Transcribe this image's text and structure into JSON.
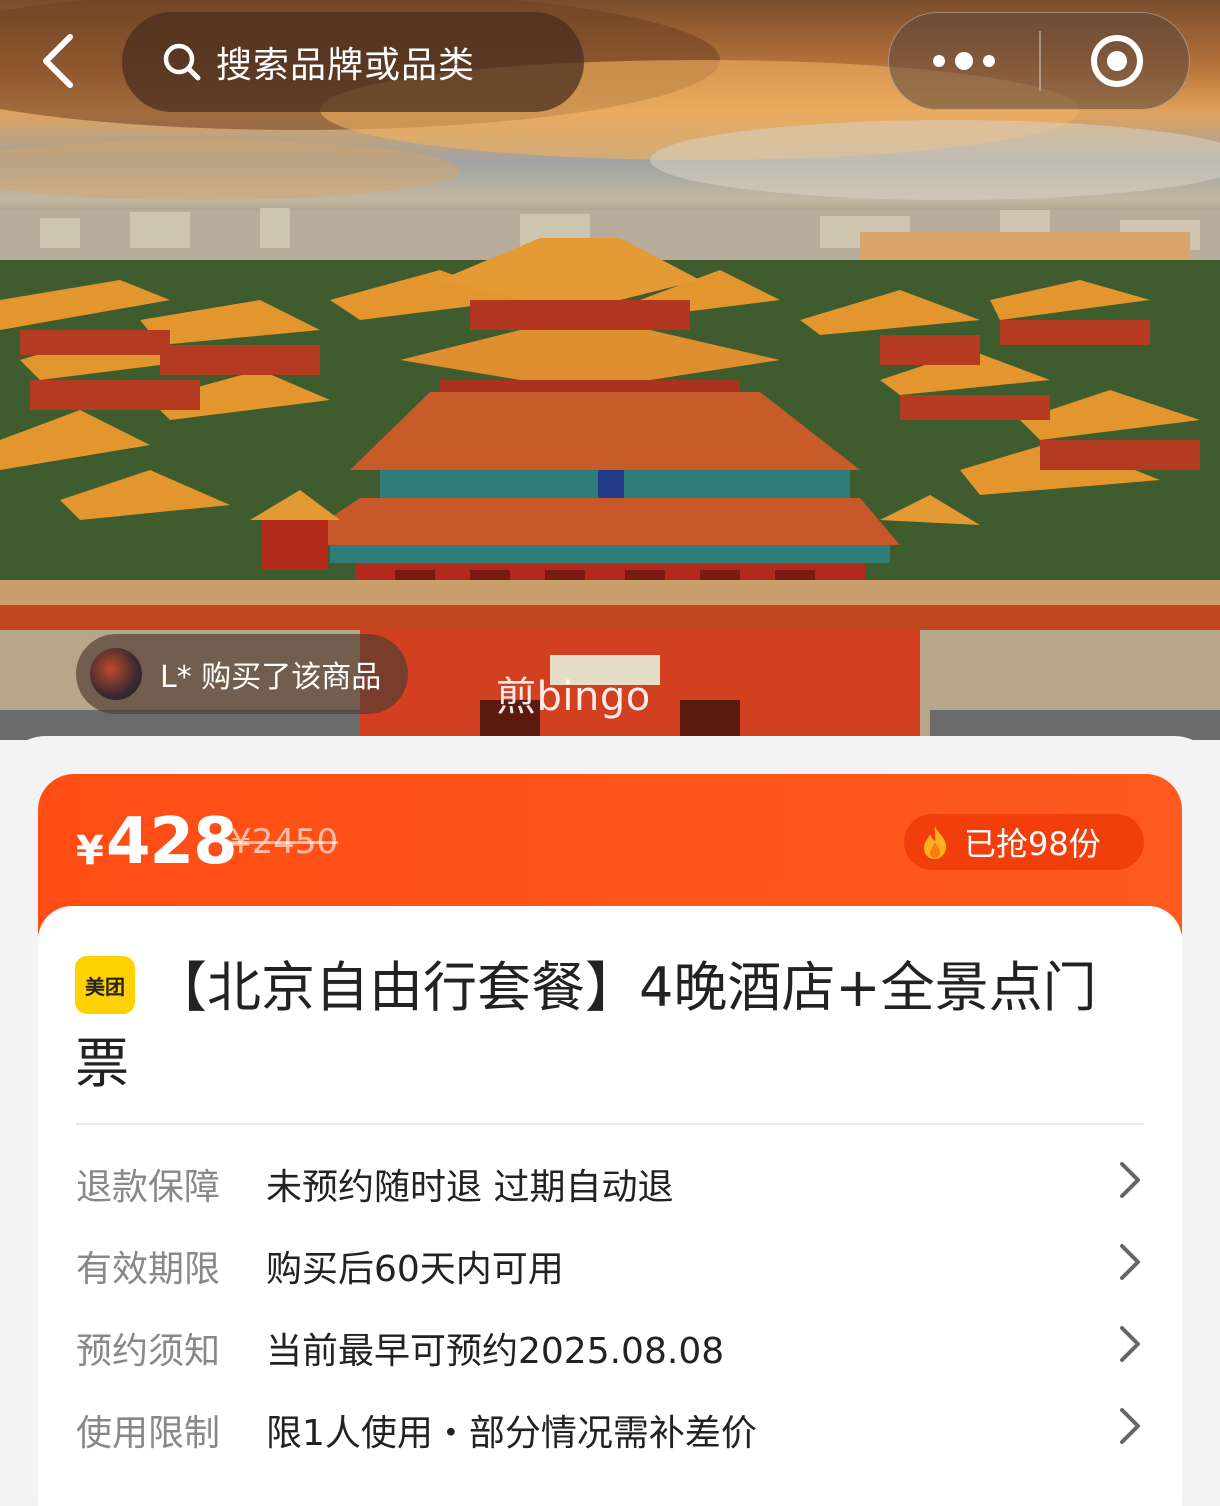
{
  "header": {
    "search_placeholder": "搜索品牌或品类",
    "icons": {
      "back": "back-arrow-icon",
      "search": "search-icon",
      "more": "more-dots-icon",
      "target": "target-icon"
    }
  },
  "hero": {
    "purchase_notice": "L* 购买了该商品",
    "watermark": "煎bingo"
  },
  "price": {
    "currency": "¥",
    "current": "428",
    "original": "¥2450",
    "sold_count": "已抢98份",
    "accent_color": "#ff4d14"
  },
  "product": {
    "brand_badge": "美团",
    "brand_color": "#ffd100",
    "title": "【北京自由行套餐】4晚酒店+全景点门票"
  },
  "info_rows": [
    {
      "label": "退款保障",
      "value": "未预约随时退 过期自动退"
    },
    {
      "label": "有效期限",
      "value": "购买后60天内可用"
    },
    {
      "label": "预约须知",
      "value": "当前最早可预约2025.08.08"
    },
    {
      "label": "使用限制",
      "value": "限1人使用・部分情况需补差价"
    }
  ]
}
